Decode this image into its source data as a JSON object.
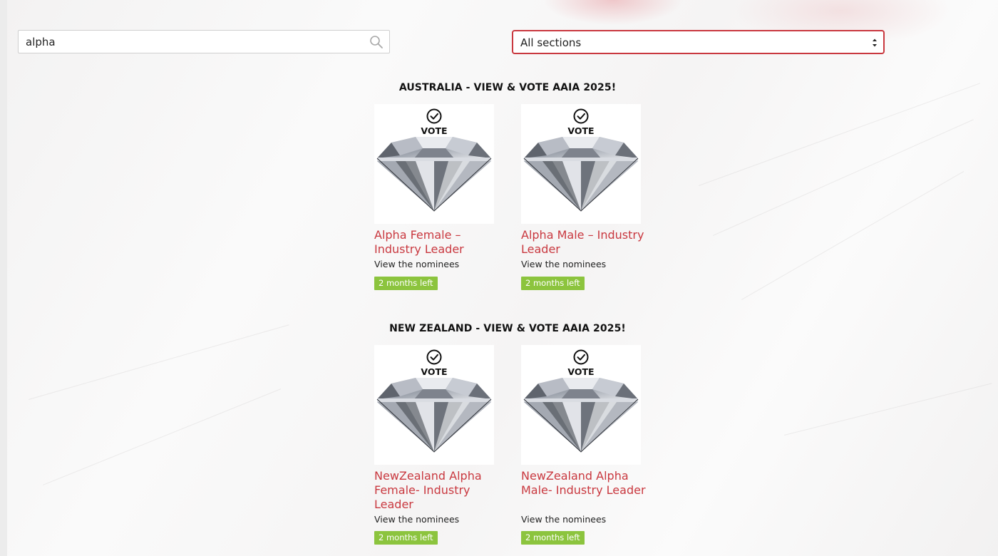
{
  "search": {
    "value": "alpha",
    "icon": "search-icon"
  },
  "filter": {
    "selected": "All sections",
    "icon": "select-arrows-icon",
    "border_color": "#c9383f"
  },
  "colors": {
    "accent": "#c9383f",
    "badge": "#8cc43e"
  },
  "sections": [
    {
      "heading": "AUSTRALIA - VIEW & VOTE AAIA 2025!",
      "cards": [
        {
          "vote_label": "VOTE",
          "title": "Alpha Female – Industry Leader",
          "subtitle": "View the nominees",
          "badge": "2 months left"
        },
        {
          "vote_label": "VOTE",
          "title": "Alpha Male – Industry Leader",
          "subtitle": "View the nominees",
          "badge": "2 months left"
        }
      ]
    },
    {
      "heading": "NEW ZEALAND - VIEW & VOTE AAIA 2025!",
      "cards": [
        {
          "vote_label": "VOTE",
          "title": "NewZealand Alpha Female- Industry Leader",
          "subtitle": "View the nominees",
          "badge": "2 months left"
        },
        {
          "vote_label": "VOTE",
          "title": "NewZealand Alpha Male- Industry Leader",
          "subtitle": "View the nominees",
          "badge": "2 months left"
        }
      ]
    }
  ]
}
